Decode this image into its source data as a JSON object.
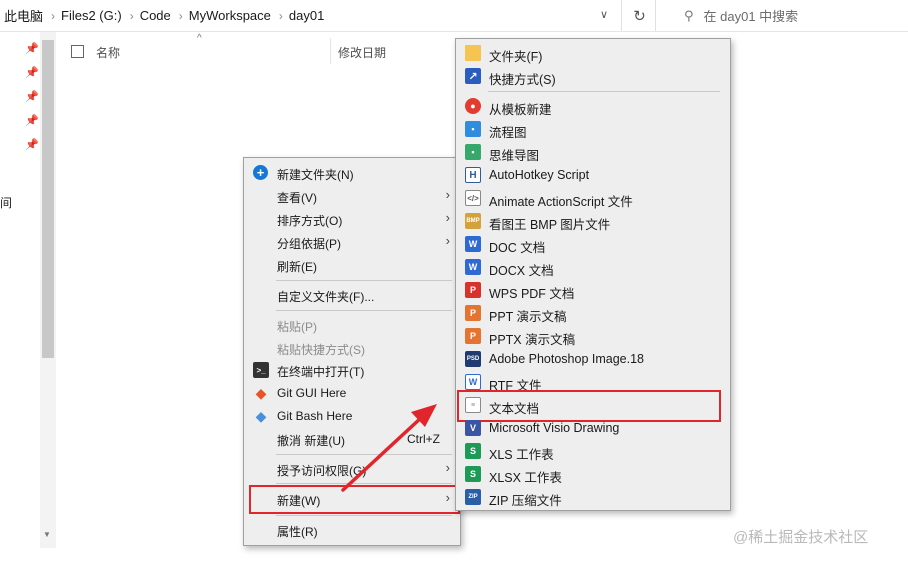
{
  "breadcrumb": [
    "此电脑",
    "Files2 (G:)",
    "Code",
    "MyWorkspace",
    "day01"
  ],
  "search": {
    "placeholder": "在 day01 中搜索"
  },
  "nav": {
    "partial_label": "间"
  },
  "columns": {
    "name": "名称",
    "date": "修改日期"
  },
  "context_menu": {
    "items": [
      {
        "label": "新建文件夹(N)",
        "icon": "new-folder-icon"
      },
      {
        "label": "查看(V)",
        "submenu": true
      },
      {
        "label": "排序方式(O)",
        "submenu": true
      },
      {
        "label": "分组依据(P)",
        "submenu": true
      },
      {
        "label": "刷新(E)"
      },
      {
        "label": "自定义文件夹(F)..."
      },
      {
        "label": "粘贴(P)",
        "disabled": true
      },
      {
        "label": "粘贴快捷方式(S)",
        "disabled": true
      },
      {
        "label": "在终端中打开(T)",
        "icon": "terminal-icon"
      },
      {
        "label": "Git GUI Here",
        "icon": "git-gui-icon"
      },
      {
        "label": "Git Bash Here",
        "icon": "git-bash-icon"
      },
      {
        "label": "撤消 新建(U)",
        "shortcut": "Ctrl+Z"
      },
      {
        "label": "授予访问权限(G)",
        "submenu": true
      },
      {
        "label": "新建(W)",
        "submenu": true,
        "highlighted": true
      },
      {
        "label": "属性(R)"
      }
    ]
  },
  "new_submenu": {
    "items": [
      {
        "label": "文件夹(F)",
        "icon": "folder-icon"
      },
      {
        "label": "快捷方式(S)",
        "icon": "shortcut-icon"
      },
      {
        "label": "从模板新建",
        "icon": "template-icon"
      },
      {
        "label": "流程图",
        "icon": "flowchart-icon"
      },
      {
        "label": "思维导图",
        "icon": "mindmap-icon"
      },
      {
        "label": "AutoHotkey Script",
        "icon": "autohotkey-icon"
      },
      {
        "label": "Animate ActionScript 文件",
        "icon": "actionscript-icon"
      },
      {
        "label": "看图王 BMP 图片文件",
        "icon": "bmp-icon"
      },
      {
        "label": "DOC 文档",
        "icon": "doc-icon"
      },
      {
        "label": "DOCX 文档",
        "icon": "docx-icon"
      },
      {
        "label": "WPS PDF 文档",
        "icon": "pdf-icon"
      },
      {
        "label": "PPT 演示文稿",
        "icon": "ppt-icon"
      },
      {
        "label": "PPTX 演示文稿",
        "icon": "pptx-icon"
      },
      {
        "label": "Adobe Photoshop Image.18",
        "icon": "psd-icon"
      },
      {
        "label": "RTF 文件",
        "icon": "rtf-icon"
      },
      {
        "label": "文本文档",
        "icon": "text-document-icon",
        "highlighted": true
      },
      {
        "label": "Microsoft Visio Drawing",
        "icon": "visio-icon"
      },
      {
        "label": "XLS 工作表",
        "icon": "xls-icon"
      },
      {
        "label": "XLSX 工作表",
        "icon": "xlsx-icon"
      },
      {
        "label": "ZIP 压缩文件",
        "icon": "zip-icon"
      }
    ]
  },
  "watermark": "@稀土掘金技术社区",
  "colors": {
    "highlight_border": "#e0262b",
    "menu_bg": "#eeeeee"
  }
}
